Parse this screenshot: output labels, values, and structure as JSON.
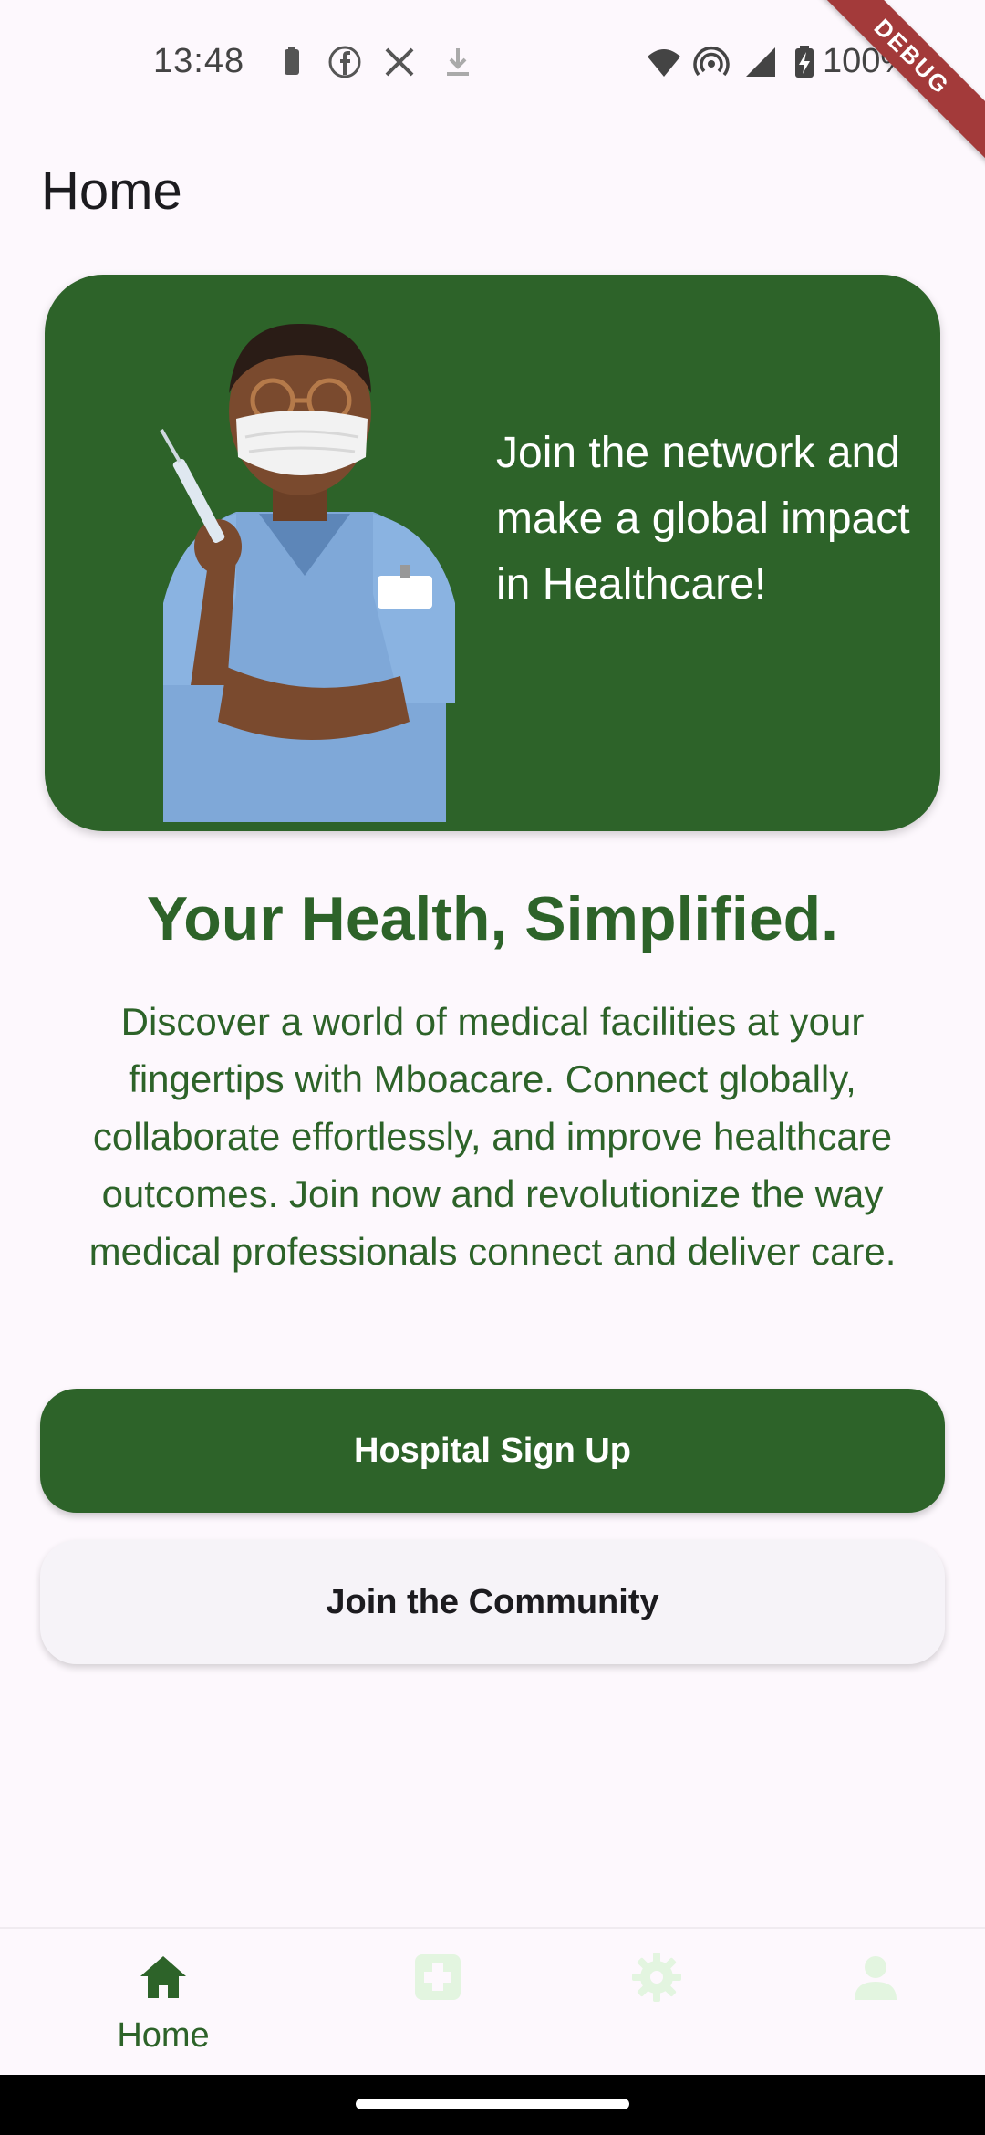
{
  "status_bar": {
    "time": "13:48",
    "battery_percent": "100%",
    "icons": [
      "battery-small-icon",
      "facebook-icon",
      "x-icon",
      "download-icon",
      "wifi-icon",
      "hotspot-icon",
      "signal-icon",
      "battery-charging-icon"
    ]
  },
  "debug_banner": "DEBUG",
  "app_bar": {
    "title": "Home"
  },
  "hero": {
    "text": "Join the network and make a global impact in Healthcare!",
    "illustration": "nurse-illustration"
  },
  "headline": "Your Health, Simplified.",
  "description": "Discover a world of medical facilities at your fingertips with Mboacare. Connect globally, collaborate effortlessly, and improve healthcare outcomes. Join now and revolutionize the way medical professionals connect and deliver care.",
  "buttons": {
    "primary": "Hospital Sign Up",
    "secondary": "Join the Community"
  },
  "bottom_nav": {
    "items": [
      {
        "label": "Home",
        "icon": "home-icon",
        "active": true
      },
      {
        "label": "",
        "icon": "medical-cross-icon",
        "active": false
      },
      {
        "label": "",
        "icon": "settings-icon",
        "active": false
      },
      {
        "label": "",
        "icon": "profile-icon",
        "active": false
      }
    ]
  },
  "colors": {
    "primary": "#2d6329",
    "background": "#fdf8fd",
    "inactive_icon": "#e3f5e0"
  }
}
